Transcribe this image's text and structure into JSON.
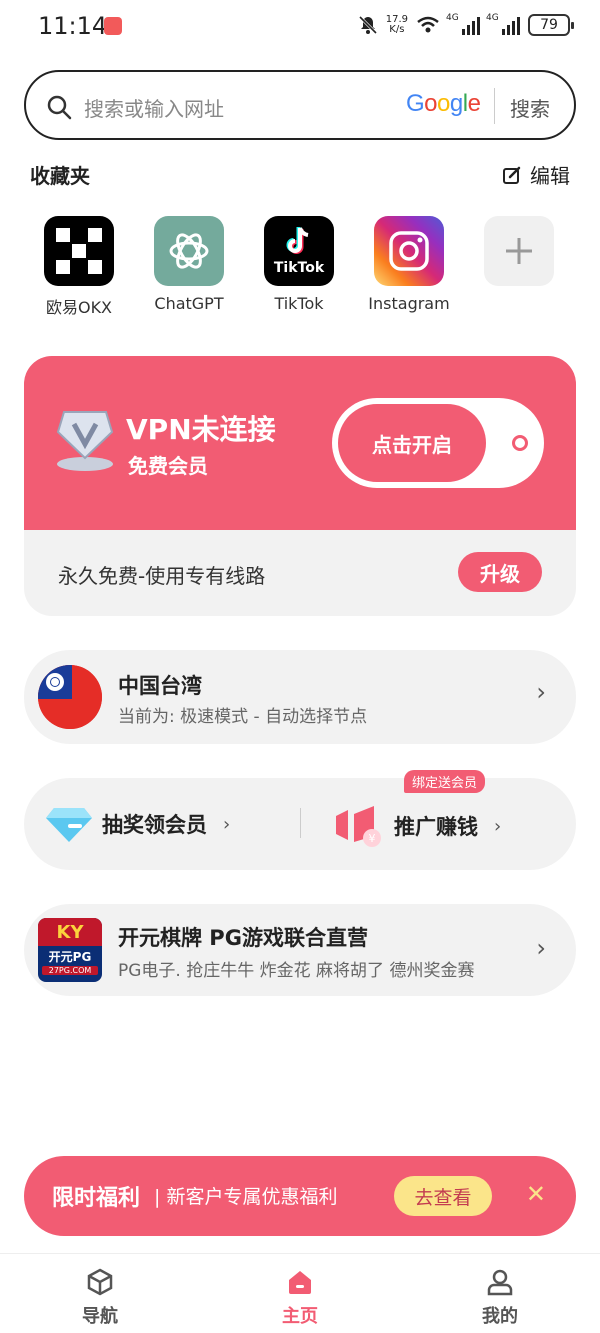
{
  "status_bar": {
    "time": "11:14",
    "speed_value": "17.9",
    "speed_unit": "K/s",
    "sig1": "4G",
    "sig2": "4G",
    "battery": "79"
  },
  "search": {
    "placeholder": "搜索或输入网址",
    "engine": "Google",
    "button": "搜索"
  },
  "favorites": {
    "title": "收藏夹",
    "edit": "编辑",
    "items": [
      {
        "label": "欧易OKX",
        "icon": "okx-icon"
      },
      {
        "label": "ChatGPT",
        "icon": "chatgpt-icon"
      },
      {
        "label": "TikTok",
        "icon": "tiktok-icon"
      },
      {
        "label": "Instagram",
        "icon": "instagram-icon"
      },
      {
        "label": "",
        "icon": "plus-icon"
      }
    ]
  },
  "vpn": {
    "title": "VPN未连接",
    "subtitle": "免费会员",
    "toggle": "点击开启",
    "permanent": "永久免费-使用专有线路",
    "upgrade": "升级"
  },
  "region": {
    "name": "中国台湾",
    "mode": "当前为: 极速模式 - 自动选择节点"
  },
  "promo": {
    "lottery": "抽奖领会员",
    "referral": "推广赚钱",
    "tag": "绑定送会员"
  },
  "ad": {
    "title": "开元棋牌 PG游戏联合直营",
    "desc": "PG电子. 抢庄牛牛 炸金花  麻将胡了 德州奖金赛",
    "logo_top": "KY",
    "logo_mid": "开元PG",
    "logo_bot": "27PG.COM"
  },
  "banner": {
    "lead": "限时福利",
    "desc": "| 新客户专属优惠福利",
    "action": "去查看"
  },
  "tabs": {
    "nav": "导航",
    "home": "主页",
    "me": "我的"
  },
  "colors": {
    "accent": "#f25c73",
    "gold": "#fbe58a"
  }
}
